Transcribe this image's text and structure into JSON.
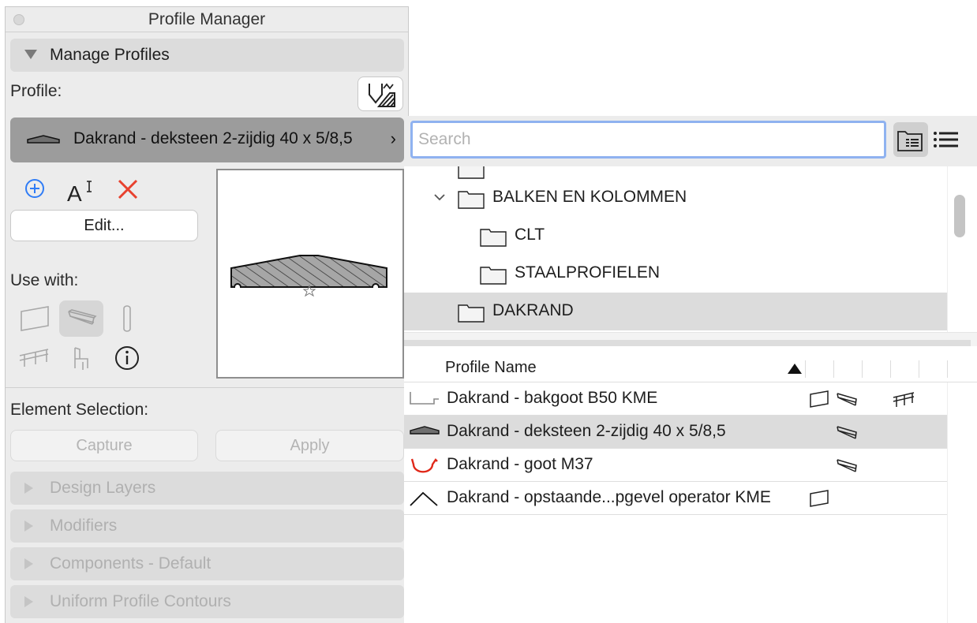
{
  "window": {
    "title": "Profile Manager"
  },
  "manage": {
    "section_label": "Manage Profiles"
  },
  "profile": {
    "label": "Profile:",
    "selected_name": "Dakrand - deksteen 2-zijdig 40 x 5/8,5"
  },
  "actions": {
    "edit_label": "Edit..."
  },
  "use_with": {
    "label": "Use with:"
  },
  "element_selection": {
    "label": "Element Selection:",
    "capture_label": "Capture",
    "apply_label": "Apply"
  },
  "sections": [
    {
      "label": "Design Layers"
    },
    {
      "label": "Modifiers"
    },
    {
      "label": "Components - Default"
    },
    {
      "label": "Uniform Profile Contours"
    }
  ],
  "search": {
    "placeholder": "Search",
    "value": ""
  },
  "tree": [
    {
      "label": "BALKEN EN KOLOMMEN",
      "expanded": true
    },
    {
      "label": "CLT"
    },
    {
      "label": "STAALPROFIELEN"
    },
    {
      "label": "DAKRAND",
      "selected": true
    }
  ],
  "list": {
    "header": "Profile Name",
    "rows": [
      {
        "name": "Dakrand - bakgoot B50 KME"
      },
      {
        "name": "Dakrand - deksteen 2-zijdig 40 x 5/8,5",
        "selected": true
      },
      {
        "name": "Dakrand - goot M37"
      },
      {
        "name": "Dakrand - opstaande...pgevel operator KME"
      }
    ]
  },
  "colors": {
    "accent_blue": "#2f7cf6",
    "delete_red": "#e8412e",
    "focus_ring": "#8fb2f0",
    "gutter_red": "#e0291a"
  }
}
